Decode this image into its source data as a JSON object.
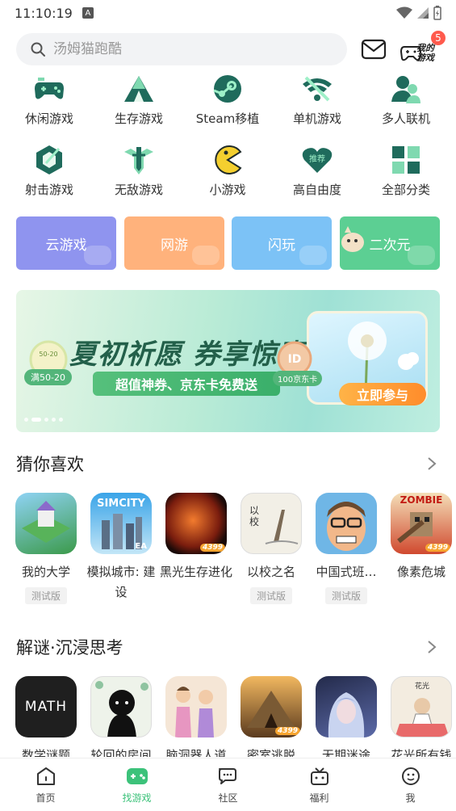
{
  "status": {
    "time": "11:10:19",
    "notif_letter": "A"
  },
  "search": {
    "placeholder": "汤姆猫跑酷"
  },
  "header": {
    "my_games_label": "我的游戏",
    "badge_count": "5"
  },
  "categories": [
    {
      "label": "休闲游戏",
      "icon": "gamepad-icon"
    },
    {
      "label": "生存游戏",
      "icon": "tent-icon"
    },
    {
      "label": "Steam移植",
      "icon": "steam-icon"
    },
    {
      "label": "单机游戏",
      "icon": "wifi-off-icon"
    },
    {
      "label": "多人联机",
      "icon": "multiplayer-icon"
    },
    {
      "label": "射击游戏",
      "icon": "target-icon"
    },
    {
      "label": "无敌游戏",
      "icon": "sword-icon"
    },
    {
      "label": "小游戏",
      "icon": "pacman-icon"
    },
    {
      "label": "高自由度",
      "icon": "heart-icon"
    },
    {
      "label": "全部分类",
      "icon": "grid-icon"
    }
  ],
  "category_badge_text": "推荐",
  "tiles": [
    {
      "label": "云游戏",
      "color": "#8f94ef"
    },
    {
      "label": "网游",
      "color": "#ffb27c"
    },
    {
      "label": "闪玩",
      "color": "#7cc2f6"
    },
    {
      "label": "二次元",
      "color": "#5ccf93"
    }
  ],
  "banner": {
    "title": "夏初祈愿 券享惊喜",
    "subtitle": "超值神券、京东卡免费送",
    "coupon_left": "满50-20",
    "coupon_right": "100京东卡",
    "cta": "立即参与",
    "coupon_left_small": "50-20",
    "card_text": "ID"
  },
  "section1": {
    "title": "猜你喜欢",
    "games": [
      {
        "name": "我的大学",
        "tag": "测试版",
        "badge": ""
      },
      {
        "name": "模拟城市: 建设",
        "tag": "",
        "badge": "",
        "icon_text": "SIMCITY",
        "icon_text2": "EA"
      },
      {
        "name": "黑光生存进化",
        "tag": "",
        "badge": "4399"
      },
      {
        "name": "以校之名",
        "tag": "测试版",
        "badge": "",
        "icon_text": "以校"
      },
      {
        "name": "中国式班…",
        "tag": "测试版",
        "badge": ""
      },
      {
        "name": "像素危城",
        "tag": "",
        "badge": "4399",
        "icon_text": "ZOMBIE"
      }
    ]
  },
  "section2": {
    "title": "解谜·沉浸思考",
    "games": [
      {
        "name": "数学谜题",
        "badge": "",
        "icon_text": "MATH"
      },
      {
        "name": "轮回的房间",
        "badge": ""
      },
      {
        "name": "脑洞器人道",
        "badge": ""
      },
      {
        "name": "密室逃脱",
        "badge": "4399"
      },
      {
        "name": "无期迷途",
        "badge": ""
      },
      {
        "name": "花光所有钱",
        "badge": "",
        "icon_text": "花光"
      }
    ]
  },
  "nav": [
    {
      "label": "首页",
      "icon": "home-icon"
    },
    {
      "label": "找游戏",
      "icon": "find-game-icon"
    },
    {
      "label": "社区",
      "icon": "community-icon"
    },
    {
      "label": "福利",
      "icon": "gift-icon"
    },
    {
      "label": "我",
      "icon": "profile-icon"
    }
  ],
  "colors": {
    "accent": "#3cc27a",
    "badge": "#ff5a4d",
    "icon_teal": "#1f6b5c"
  }
}
